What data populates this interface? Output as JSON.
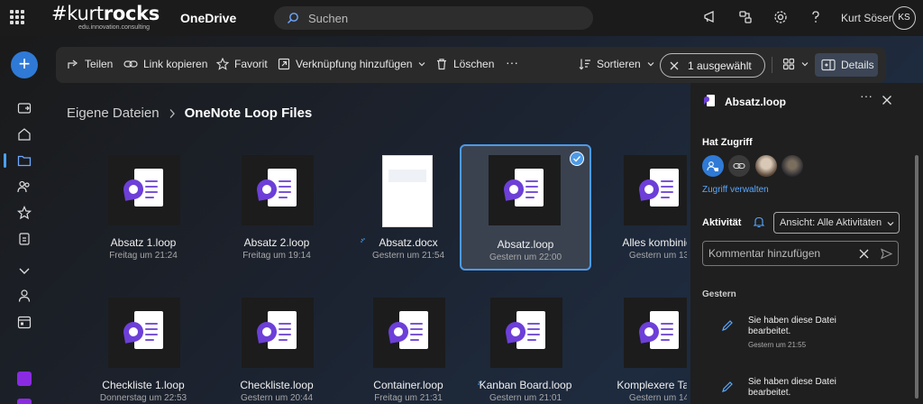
{
  "header": {
    "brand_name": "#kurtrocks",
    "brand_tagline": "edu.innovation.consulting",
    "app_name": "OneDrive",
    "search_placeholder": "Suchen",
    "user_name": "Kurt Söser",
    "user_initials": "KS"
  },
  "commandbar": {
    "share": "Teilen",
    "copy_link": "Link kopieren",
    "favorite": "Favorit",
    "add_shortcut": "Verknüpfung hinzufügen",
    "delete": "Löschen",
    "more": "···",
    "sort": "Sortieren",
    "selected": "1 ausgewählt",
    "details": "Details"
  },
  "breadcrumb": {
    "root": "Eigene Dateien",
    "current": "OneNote Loop Files"
  },
  "files": [
    {
      "name": "Absatz 1.loop",
      "date": "Freitag um 21:24",
      "type": "loop",
      "selected": false
    },
    {
      "name": "Absatz 2.loop",
      "date": "Freitag um 19:14",
      "type": "loop",
      "selected": false
    },
    {
      "name": "Absatz.docx",
      "date": "Gestern um 21:54",
      "type": "docx",
      "selected": false
    },
    {
      "name": "Absatz.loop",
      "date": "Gestern um 22:00",
      "type": "loop",
      "selected": true
    },
    {
      "name": "Alles kombinier",
      "date": "Gestern um 13",
      "type": "loop",
      "selected": false
    },
    {
      "name": "Checkliste 1.loop",
      "date": "Donnerstag um 22:53",
      "type": "loop",
      "selected": false
    },
    {
      "name": "Checkliste.loop",
      "date": "Gestern um 20:44",
      "type": "loop",
      "selected": false
    },
    {
      "name": "Container.loop",
      "date": "Freitag um 21:31",
      "type": "loop",
      "selected": false
    },
    {
      "name": "Kanban Board.loop",
      "date": "Gestern um 21:01",
      "type": "loop",
      "selected": false
    },
    {
      "name": "Komplexere Tabe",
      "date": "Gestern um 14",
      "type": "loop",
      "selected": false
    }
  ],
  "details_panel": {
    "file_name": "Absatz.loop",
    "more": "···",
    "access_heading": "Hat Zugriff",
    "manage_access": "Zugriff verwalten",
    "activity_heading": "Aktivität",
    "activity_filter": "Ansicht: Alle Aktivitäten",
    "comment_placeholder": "Kommentar hinzufügen",
    "group_label": "Gestern",
    "activities": [
      {
        "text": "Sie haben diese Datei bearbeitet.",
        "time": "Gestern um 21:55"
      },
      {
        "text": "Sie haben diese Datei bearbeitet.",
        "time": ""
      }
    ]
  },
  "colors": {
    "accent": "#4c9ae8",
    "loop_purple": "#6d3fd8",
    "new_button": "#2f7ad6"
  }
}
